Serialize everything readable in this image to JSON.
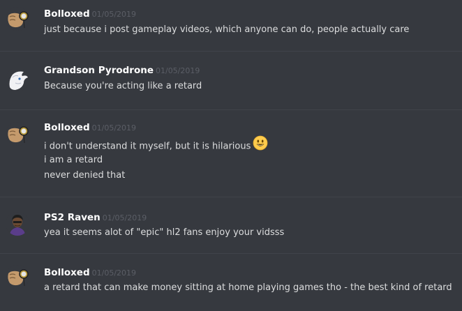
{
  "messages": [
    {
      "author": "Bolloxed",
      "timestamp": "01/05/2019",
      "avatar_icon": "monocle-hand-icon",
      "lines": [
        "just because i post gameplay videos, which anyone can do,  people actually care"
      ]
    },
    {
      "author": "Grandson Pyrodrone",
      "timestamp": "01/05/2019",
      "avatar_icon": "white-bird-icon",
      "lines": [
        "Because you're acting like a retard"
      ]
    },
    {
      "author": "Bolloxed",
      "timestamp": "01/05/2019",
      "avatar_icon": "monocle-hand-icon",
      "lines": [
        "i don't understand it myself, but it is hilarious",
        "i am a retard",
        "never denied that"
      ],
      "emoji": "smiley-emoji-icon"
    },
    {
      "author": "PS2 Raven",
      "timestamp": "01/05/2019",
      "avatar_icon": "raven-character-icon",
      "lines": [
        "yea it seems alot of \"epic\" hl2 fans enjoy your vidsss"
      ]
    },
    {
      "author": "Bolloxed",
      "timestamp": "01/05/2019",
      "avatar_icon": "monocle-hand-icon",
      "lines": [
        "a retard that can make money sitting at home playing games tho - the best kind of retard"
      ]
    }
  ],
  "colors": {
    "background": "#36393f",
    "divider": "#40434a",
    "username": "#ffffff",
    "timestamp": "#5b5e66",
    "text": "#dcddde"
  }
}
